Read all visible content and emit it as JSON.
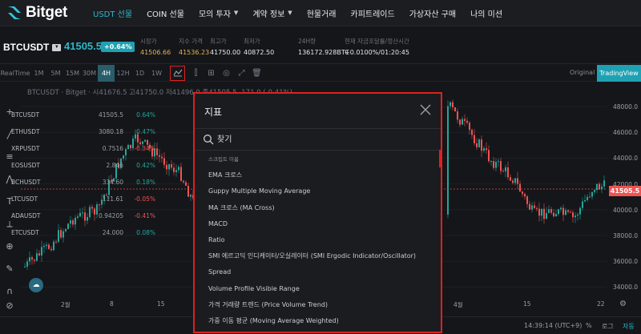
{
  "brand": {
    "name": "Bitget"
  },
  "nav": {
    "items": [
      {
        "label": "USDT 선물",
        "active": true,
        "caret": false
      },
      {
        "label": "COIN 선물",
        "active": false,
        "caret": false
      },
      {
        "label": "모의 투자",
        "active": false,
        "caret": true
      },
      {
        "label": "계약 정보",
        "active": false,
        "caret": true
      },
      {
        "label": "현물거래",
        "active": false,
        "caret": false
      },
      {
        "label": "카피트레이드",
        "active": false,
        "caret": false
      },
      {
        "label": "가상자산 구매",
        "active": false,
        "caret": false
      },
      {
        "label": "나의 미션",
        "active": false,
        "caret": false
      }
    ]
  },
  "ticker": {
    "pair": "BTCUSDT",
    "last_price": "41505.5",
    "change_badge": "+0.64%",
    "stats": [
      {
        "label": "시장가",
        "value": "41506.66",
        "gold": true
      },
      {
        "label": "지수 가격",
        "value": "41536.23",
        "gold": true
      },
      {
        "label": "최고가",
        "value": "41750.00",
        "gold": false
      },
      {
        "label": "최저가",
        "value": "40872.50",
        "gold": false
      },
      {
        "label": "24H량",
        "value": "136172.928BTC",
        "gold": false
      },
      {
        "label": "현재 자금조달률/정산시간",
        "value": "+0.0100%/01:20:45",
        "gold": false
      }
    ]
  },
  "toolbar": {
    "realtime": "RealTime",
    "timeframes": [
      "1M",
      "5M",
      "15M",
      "30M",
      "4H",
      "12H",
      "1D",
      "1W"
    ],
    "active_timeframe": "4H",
    "view_original": "Original",
    "view_tradingview": "TradingView"
  },
  "chart": {
    "title": "BTCUSDT · Bitget · 시41676.5 고41750.0 저41496.0 종41505.5 -171.0 (-0.41%)",
    "price_ticks": [
      "48000.0",
      "46000.0",
      "44000.0",
      "42000.0",
      "40000.0",
      "38000.0",
      "36000.0",
      "34000.0"
    ],
    "current_price_tag": "41505.5",
    "time_ticks": [
      "2월",
      "8",
      "15",
      "4월",
      "15",
      "22"
    ],
    "clock": "14:39:14 (UTC+9)",
    "bottom_percent": "%",
    "bottom_log": "로그",
    "bottom_auto": "자동"
  },
  "watchlist": [
    {
      "symbol": "BTCUSDT",
      "price": "41505.5",
      "change": "0.64%",
      "color": "#26a69a"
    },
    {
      "symbol": "ETHUSDT",
      "price": "3080.18",
      "change": "0.47%",
      "color": "#26a69a"
    },
    {
      "symbol": "XRPUSDT",
      "price": "0.7516",
      "change": "-0.34%",
      "color": "#ef5350"
    },
    {
      "symbol": "EOSUSDT",
      "price": "2.846",
      "change": "0.42%",
      "color": "#26a69a"
    },
    {
      "symbol": "BCHUSDT",
      "price": "334.60",
      "change": "0.18%",
      "color": "#26a69a"
    },
    {
      "symbol": "LTCUSDT",
      "price": "111.61",
      "change": "-0.05%",
      "color": "#ef5350"
    },
    {
      "symbol": "ADAUSDT",
      "price": "0.94205",
      "change": "-0.41%",
      "color": "#ef5350"
    },
    {
      "symbol": "ETCUSDT",
      "price": "24.000",
      "change": "0.08%",
      "color": "#26a69a"
    }
  ],
  "dialog": {
    "title": "지표",
    "search_placeholder": "찾기",
    "items": [
      "스크립트 이름",
      "EMA 크로스",
      "Guppy Multiple Moving Average",
      "MA 크로스 (MA Cross)",
      "MACD",
      "Ratio",
      "SMI 에르고딕 인디케이터/오실레이터 (SMI Ergodic Indicator/Oscillator)",
      "Spread",
      "Volume Profile Visible Range",
      "가격 거래량 트렌드 (Price Volume Trend)",
      "가중 이동 평균 (Moving Average Weighted)"
    ]
  },
  "colors": {
    "accent": "#2eb7c9",
    "up": "#26a69a",
    "down": "#ef5350",
    "highlight": "#e02020",
    "gold": "#e5b34c"
  },
  "icons": [
    "bitget-logo-icon",
    "pair-dropdown-icon",
    "indicator-icon",
    "compare-icon",
    "template-icon",
    "camera-icon",
    "fullscreen-icon",
    "trash-icon",
    "close-icon",
    "search-icon",
    "settings-icon",
    "magnet-icon",
    "crosshair-icon",
    "zoom-icon"
  ]
}
